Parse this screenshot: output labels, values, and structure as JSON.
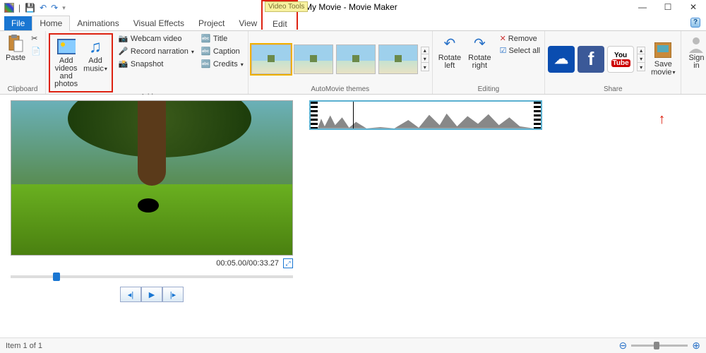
{
  "window": {
    "title": "My Movie - Movie Maker",
    "contextual_tab_group": "Video Tools",
    "contextual_tab": "Edit",
    "controls": {
      "minimize": "—",
      "maximize": "☐",
      "close": "✕"
    }
  },
  "qat": {
    "save": "💾",
    "undo": "↶",
    "redo": "↷",
    "more": "▾"
  },
  "tabs": {
    "file": "File",
    "home": "Home",
    "animations": "Animations",
    "visual_effects": "Visual Effects",
    "project": "Project",
    "view": "View"
  },
  "ribbon": {
    "clipboard": {
      "label": "Clipboard",
      "paste": "Paste",
      "cut": "✂",
      "copy": "📄"
    },
    "add": {
      "label": "Add",
      "add_videos": "Add videos\nand photos",
      "add_music": "Add\nmusic",
      "webcam": "Webcam video",
      "narration": "Record narration",
      "snapshot": "Snapshot",
      "title": "Title",
      "caption": "Caption",
      "credits": "Credits"
    },
    "automovie": {
      "label": "AutoMovie themes"
    },
    "editing": {
      "label": "Editing",
      "rotate_left": "Rotate\nleft",
      "rotate_right": "Rotate\nright",
      "remove": "Remove",
      "select_all": "Select all"
    },
    "share": {
      "label": "Share",
      "onedrive": "☁",
      "facebook": "f",
      "youtube_top": "You",
      "youtube_bot": "Tube",
      "save_movie": "Save\nmovie"
    },
    "signin": {
      "label": "Sign\nin"
    }
  },
  "preview": {
    "time": "00:05.00/00:33.27",
    "prev": "◂|",
    "play": "▶",
    "next": "|▸",
    "fullscreen": "⤢"
  },
  "status": {
    "item": "Item 1 of 1",
    "zoom_out": "⊖",
    "zoom_in": "⊕"
  }
}
